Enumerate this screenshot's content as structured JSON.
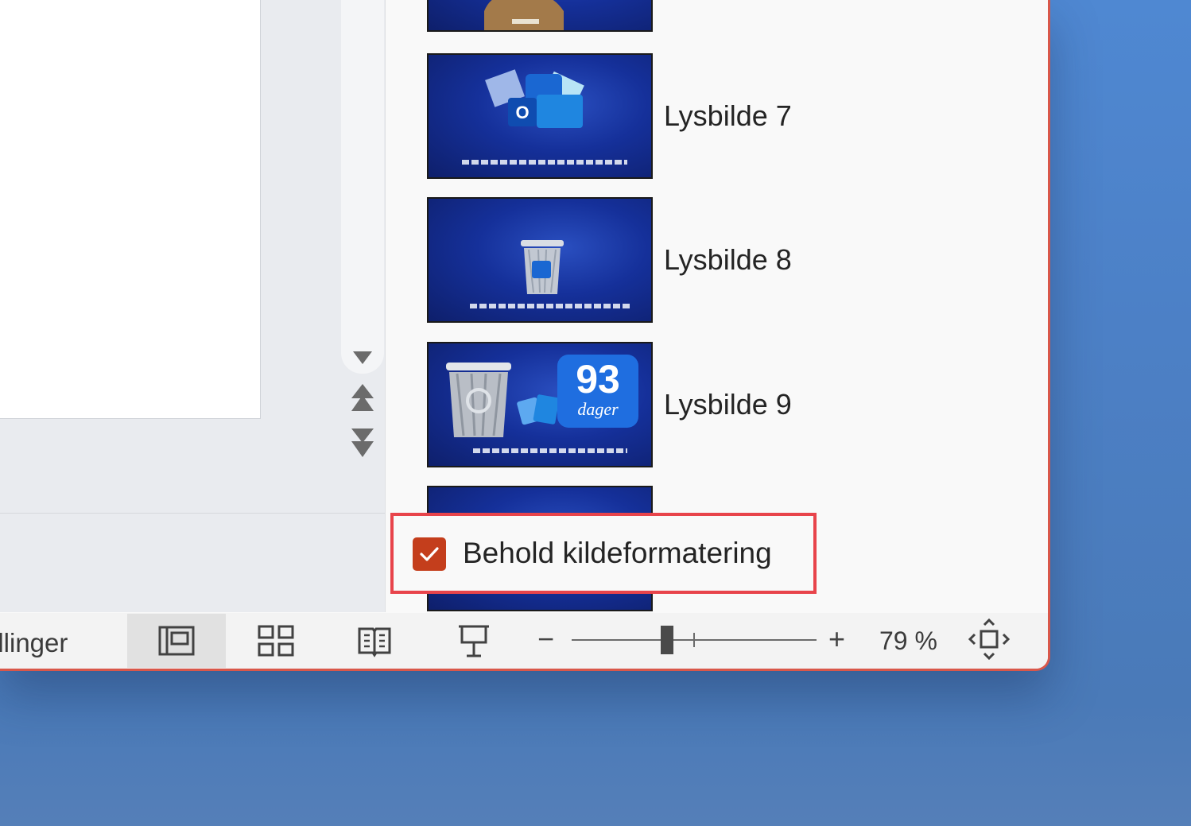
{
  "statusbar": {
    "partial_text": "illinger",
    "zoom_level": "79 %",
    "views": [
      "normal-view-icon",
      "slide-sorter-icon",
      "reading-view-icon",
      "slideshow-icon"
    ]
  },
  "reuse_pane": {
    "slides": [
      {
        "label": ""
      },
      {
        "label": "Lysbilde 7"
      },
      {
        "label": "Lysbilde 8"
      },
      {
        "label": "Lysbilde 9",
        "badge_number": "93",
        "badge_text": "dager"
      },
      {
        "label": ""
      }
    ],
    "keep_source_formatting": {
      "label": "Behold kildeformatering",
      "checked": true
    }
  },
  "colors": {
    "accent": "#c43e1c",
    "highlight_border": "#e8444b",
    "thumb_bg": "#15309a",
    "desktop": "#4f88d2"
  }
}
